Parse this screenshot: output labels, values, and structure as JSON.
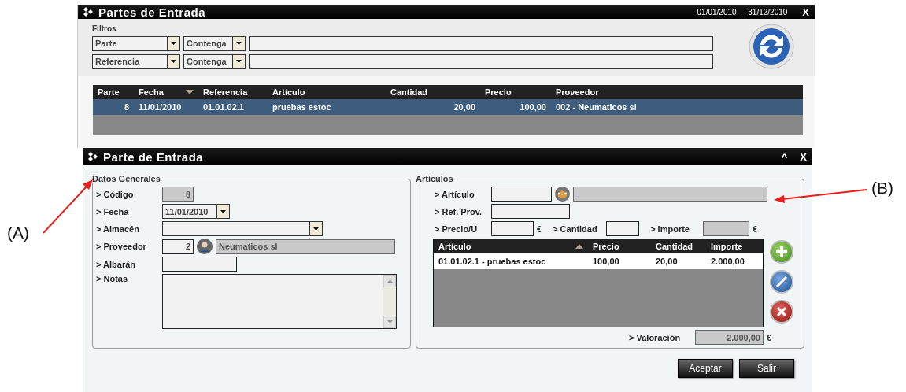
{
  "back_window": {
    "title": "Partes de Entrada",
    "date_from": "01/01/2010",
    "date_separator": "--",
    "date_to": "31/12/2010",
    "close": "X",
    "filters": {
      "label": "Filtros",
      "rows": [
        {
          "field": "Parte",
          "operator": "Contenga"
        },
        {
          "field": "Referencia",
          "operator": "Contenga"
        }
      ]
    },
    "table": {
      "sort_descending": true,
      "columns": [
        {
          "label": "Parte",
          "sorted": false
        },
        {
          "label": "Fecha",
          "sorted": true
        },
        {
          "label": "Referencia",
          "sorted": false
        },
        {
          "label": "Artículo",
          "sorted": false
        },
        {
          "label": "Cantidad",
          "sorted": false
        },
        {
          "label": "Precio",
          "sorted": false
        },
        {
          "label": "Proveedor",
          "sorted": false
        }
      ],
      "rows": [
        {
          "selected": true,
          "cells": [
            "8",
            "11/01/2010",
            "01.01.02.1",
            "pruebas estoc",
            "20,00",
            "100,00",
            "002 - Neumaticos sl"
          ]
        }
      ]
    }
  },
  "front_window": {
    "title": "Parte de Entrada",
    "minimize": "^",
    "close": "X",
    "general": {
      "legend": "Datos Generales",
      "fields": [
        {
          "kind": "text",
          "label": "> Código",
          "value": "8",
          "readonly": true
        },
        {
          "kind": "dropdown",
          "label": "> Fecha",
          "value": "11/01/2010",
          "readonly": false
        },
        {
          "kind": "dropdown",
          "label": "> Almacén",
          "readonly": false
        },
        {
          "kind": "lookup",
          "label": "> Proveedor",
          "value": "2",
          "name": "Neumaticos sl",
          "readonly": true
        },
        {
          "kind": "text",
          "label": "> Albarán",
          "readonly": false
        },
        {
          "kind": "textarea",
          "label": "> Notas",
          "readonly": false
        }
      ]
    },
    "articles": {
      "legend": "Artículos",
      "article": {
        "label": "> Artículo",
        "readonly": true
      },
      "supplier_ref": {
        "label": "> Ref. Prov."
      },
      "unit_price": {
        "label": "> Precio/U",
        "currency": "€",
        "readonly": false
      },
      "quantity": {
        "label": "> Cantidad",
        "readonly": false
      },
      "amount": {
        "label": "> Importe",
        "currency": "€",
        "readonly": true
      },
      "table": {
        "sort_descending": false,
        "columns": [
          {
            "label": "Artículo",
            "sorted": true
          },
          {
            "label": "Precio",
            "sorted": false
          },
          {
            "label": "Cantidad",
            "sorted": false
          },
          {
            "label": "Importe",
            "sorted": false
          }
        ],
        "rows": [
          {
            "selected": false,
            "cells": [
              "01.01.02.1 - pruebas estoc",
              "100,00",
              "20,00",
              "2.000,00"
            ]
          }
        ]
      },
      "actions": [
        {
          "kind": "add"
        },
        {
          "kind": "edit"
        },
        {
          "kind": "delete"
        }
      ],
      "valuation": {
        "label": "> Valoración",
        "value": "2.000,00",
        "currency": "€",
        "readonly": true
      }
    },
    "buttons": [
      "Aceptar",
      "Salir"
    ]
  },
  "annotations": [
    {
      "label": "(A)"
    },
    {
      "label": "(B)"
    }
  ]
}
